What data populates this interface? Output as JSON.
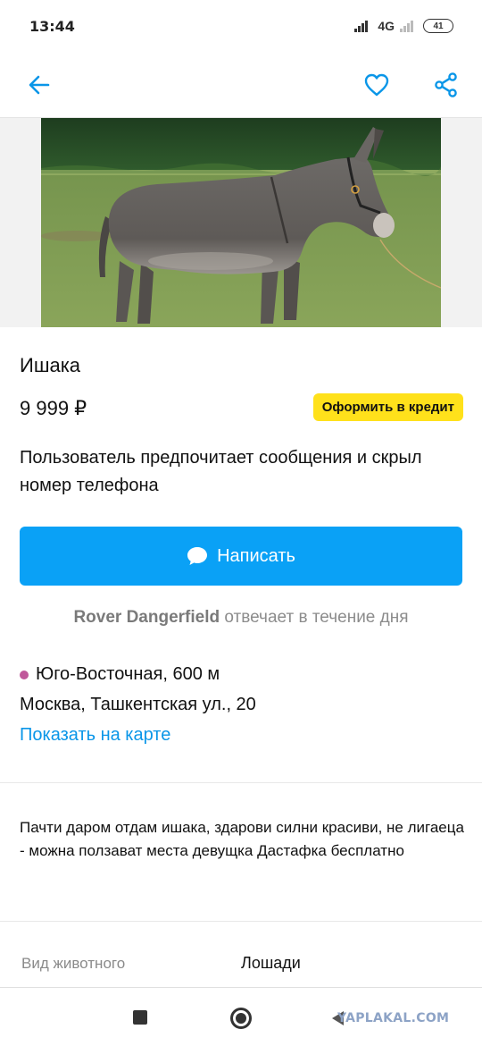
{
  "status_bar": {
    "time": "13:44",
    "network": "4G",
    "battery": "41"
  },
  "app_bar": {
    "back_icon": "arrow-left-icon",
    "favorite_icon": "heart-icon",
    "share_icon": "share-icon",
    "accent_color": "#0a96e8"
  },
  "listing": {
    "photo_icon": "donkey-photo",
    "title": "Ишака",
    "price": "9 999 ₽",
    "credit_button": "Оформить в кредит",
    "contact_preference": "Пользователь предпочитает сообщения и скрыл номер телефона",
    "write_button": "Написать",
    "seller_name": "Rover Dangerfield",
    "response_time": "отвечает в течение дня",
    "metro_station": "Юго-Восточная, 600 м",
    "metro_color": "#c0589b",
    "address": "Москва, Ташкентская ул., 20",
    "map_link": "Показать на карте",
    "description": "Пачти даром отдам ишака, здарови силни красиви, не лигаеца - можна ползават места девущка Дастафка бесплатно",
    "params": [
      {
        "label": "Вид животного",
        "value": "Лошади"
      }
    ]
  },
  "colors": {
    "primary_button": "#0aa1f6",
    "credit_badge": "#ffe11b"
  },
  "watermark": "YAPLAKAL.COM"
}
